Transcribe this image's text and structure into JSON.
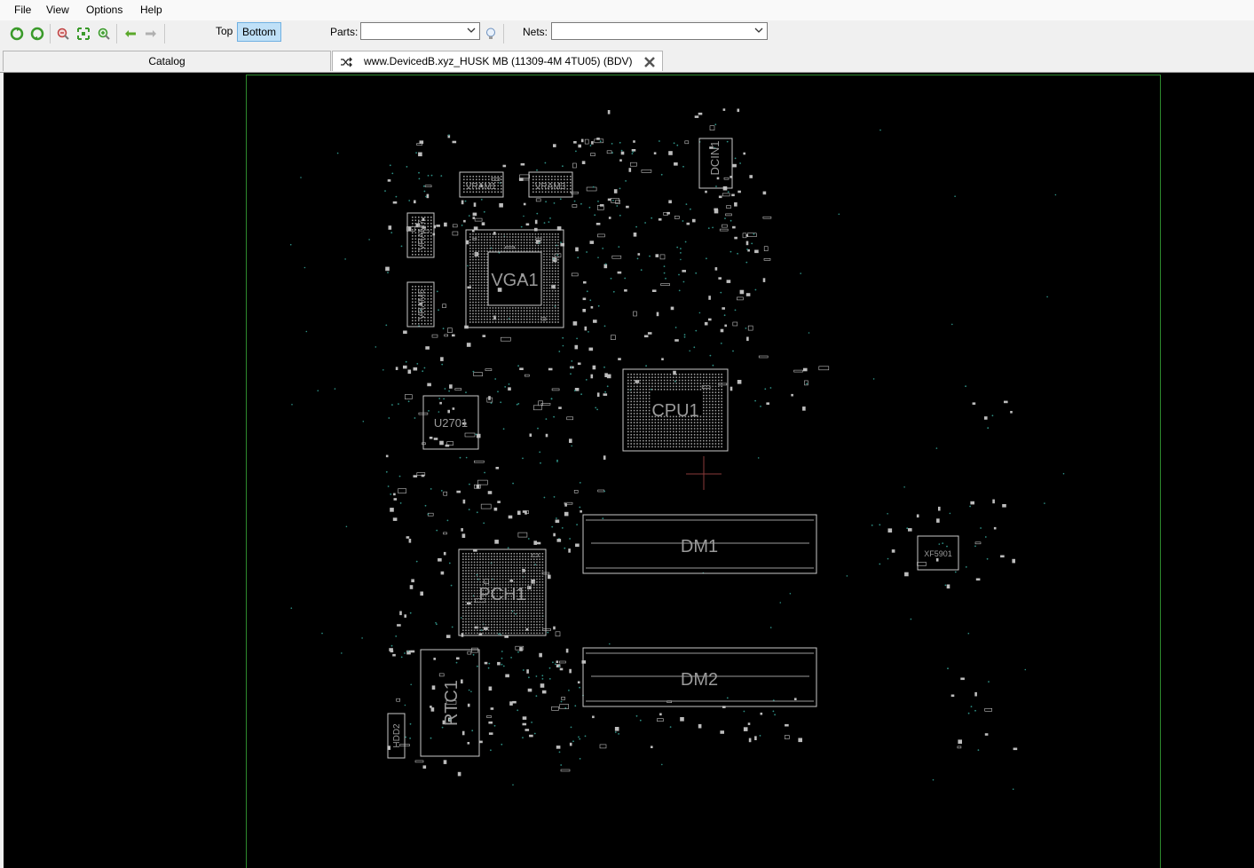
{
  "menu": {
    "file": "File",
    "view": "View",
    "options": "Options",
    "help": "Help"
  },
  "toolbar": {
    "icons": [
      "refresh-green-icon",
      "rotate-green-icon",
      "zoom-out-icon",
      "fit-to-screen-icon",
      "zoom-in-icon",
      "back-arrow-icon",
      "forward-arrow-icon"
    ],
    "top_label": "Top",
    "bottom_label": "Bottom",
    "parts_label": "Parts:",
    "parts_value": "",
    "nets_label": "Nets:",
    "nets_value": "",
    "highlight_icon": "bulb-icon"
  },
  "tabs": {
    "catalog": "Catalog",
    "document": "www.DevicedB.xyz_HUSK MB (11309-4M 4TU05) (BDV)"
  },
  "colors": {
    "board_outline": "#2e8a2e",
    "part_outline": "#c8c8c8",
    "pads": "#bdbdbd",
    "vias": "#2e8f84",
    "active_side": "#bfe0f7"
  },
  "board": {
    "parts": {
      "dcin1": "DCIN1",
      "vram1": "VRAM1",
      "vram3": "VRAM3",
      "vram7": "VRAM7",
      "vram5": "VRAM5",
      "vga1": "VGA1",
      "cpu1": "CPU1",
      "u2701": "U2701",
      "dm1": "DM1",
      "dm2": "DM2",
      "pch1": "PCH1",
      "rtc1": "RTC1",
      "hdd2": "HDD2",
      "xf5901": "XF5901"
    }
  }
}
